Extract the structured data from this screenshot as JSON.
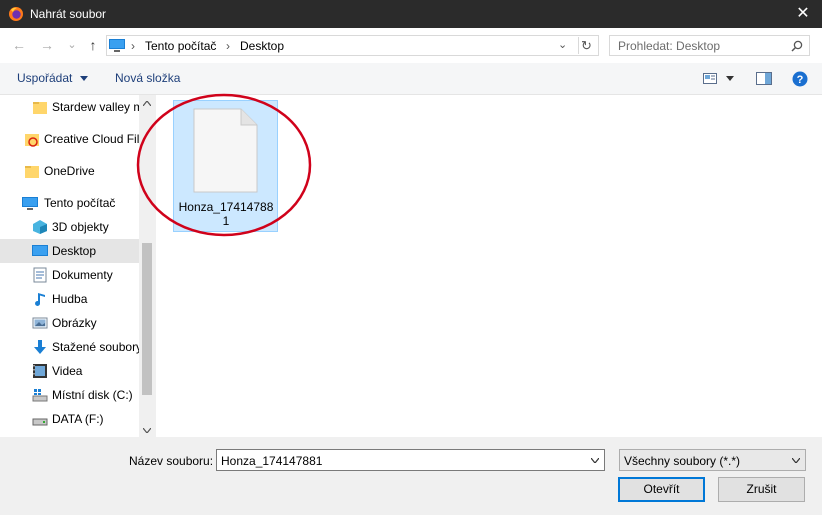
{
  "window": {
    "title": "Nahrát soubor",
    "close_glyph": "✕"
  },
  "nav": {
    "back": "←",
    "forward": "→",
    "dropdown": "⌄",
    "up": "↑",
    "refresh": "↻",
    "crumb_sep": "›"
  },
  "breadcrumb": [
    "Tento počítač",
    "Desktop"
  ],
  "search": {
    "placeholder": "Prohledat: Desktop"
  },
  "toolbar": {
    "organize": "Uspořádat",
    "new_folder": "Nová složka"
  },
  "sidebar": {
    "items": [
      {
        "label": "Stardew valley m",
        "icon": "folder-icon"
      },
      {
        "label": "Creative Cloud Fil",
        "icon": "creative-cloud-icon"
      },
      {
        "label": "OneDrive",
        "icon": "folder-icon"
      },
      {
        "label": "Tento počítač",
        "icon": "computer-icon"
      },
      {
        "label": "3D objekty",
        "icon": "3d-objects-icon"
      },
      {
        "label": "Desktop",
        "icon": "desktop-icon",
        "selected": true
      },
      {
        "label": "Dokumenty",
        "icon": "documents-icon"
      },
      {
        "label": "Hudba",
        "icon": "music-icon"
      },
      {
        "label": "Obrázky",
        "icon": "pictures-icon"
      },
      {
        "label": "Stažené soubory",
        "icon": "downloads-icon"
      },
      {
        "label": "Videa",
        "icon": "videos-icon"
      },
      {
        "label": "Místní disk (C:)",
        "icon": "local-disk-icon"
      },
      {
        "label": "DATA (F:)",
        "icon": "drive-icon"
      }
    ]
  },
  "files": [
    {
      "line1": "Honza_17414788",
      "line2": "1",
      "selected": true
    }
  ],
  "footer": {
    "filename_label": "Název souboru:",
    "filename_value": "Honza_174147881",
    "filter_value": "Všechny soubory (*.*)",
    "open_label": "Otevřít",
    "cancel_label": "Zrušit"
  },
  "colors": {
    "accent": "#0078d7",
    "selection": "#cce8ff",
    "annotation_circle": "#d0021b"
  }
}
